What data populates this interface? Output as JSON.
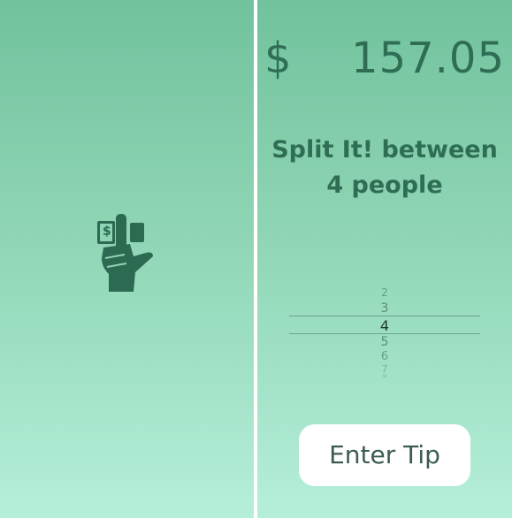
{
  "splash": {
    "logo_icon": "hand-holding-dollar-icon",
    "logo_glyph": "$",
    "logo_color": "#2d6a52"
  },
  "split_screen": {
    "currency_symbol": "$",
    "amount": "157.05",
    "headline_line1": "Split It! between",
    "headline_line2": "4 people",
    "picker": {
      "options": [
        "2",
        "3",
        "4",
        "5",
        "6",
        "7",
        "8"
      ],
      "selected": "4"
    },
    "tip_button_label": "Enter Tip"
  },
  "colors": {
    "gradient_top": "#71c29d",
    "gradient_bottom": "#b5efd9",
    "text_dark_green": "#2f6e55",
    "button_bg": "#ffffff"
  }
}
